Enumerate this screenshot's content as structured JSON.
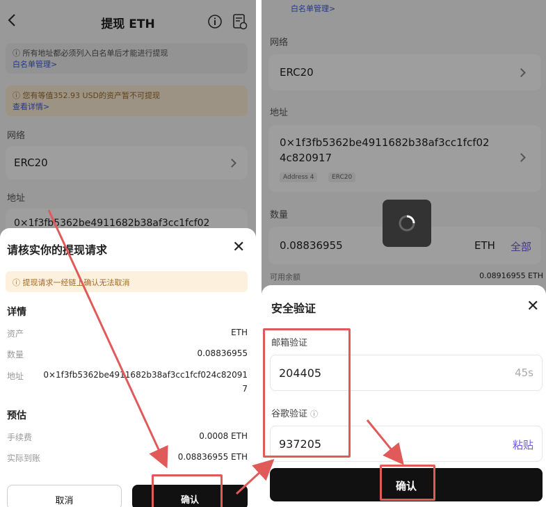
{
  "left": {
    "header": {
      "title": "提现 ETH"
    },
    "notice_whitelist": {
      "text": "所有地址都必须列入白名单后才能进行提现",
      "link": "白名单管理>"
    },
    "notice_assets": {
      "text": "您有等值352.93 USD的资产暂不可提现",
      "link": "查看详情>"
    },
    "network_label": "网络",
    "network_value": "ERC20",
    "address_label": "地址",
    "address_value_partial": "0×1f3fb5362be4911682b38af3cc1fcf02",
    "sheet": {
      "title": "请核实你的提现请求",
      "warning": "提现请求一经链上确认无法取消",
      "details_title": "详情",
      "asset_label": "资产",
      "asset_value": "ETH",
      "amount_label": "数量",
      "amount_value": "0.08836955",
      "address_label": "地址",
      "address_value_line1": "0×1f3fb5362be4911682b38af3cc1fcf024c82091",
      "address_value_line2": "7",
      "estimate_title": "预估",
      "fee_label": "手续费",
      "fee_value": "0.0008 ETH",
      "received_label": "实际到账",
      "received_value": "0.08836955 ETH",
      "cancel_label": "取消",
      "confirm_label": "确认"
    }
  },
  "right": {
    "top_link": "白名单管理>",
    "network_label": "网络",
    "network_value": "ERC20",
    "address_label": "地址",
    "address_value_line1": "0×1f3fb5362be4911682b38af3cc1fcf02",
    "address_value_line2": "4c820917",
    "address_tag1": "Address 4",
    "address_tag2": "ERC20",
    "amount_label": "数量",
    "amount_value": "0.08836955",
    "amount_unit": "ETH",
    "amount_all": "全部",
    "available_label": "可用余额",
    "available_value": "0.08916955 ETH",
    "sheet": {
      "title": "安全验证",
      "email_label": "邮箱验证",
      "email_code": "204405",
      "email_timer": "45s",
      "google_label": "谷歌验证",
      "google_code": "937205",
      "paste_label": "粘贴",
      "confirm_label": "确认"
    }
  },
  "colors": {
    "annotation_red": "#e05a5a",
    "link_blue": "#3b5bd6",
    "accent_purple": "#6b5bd6"
  }
}
